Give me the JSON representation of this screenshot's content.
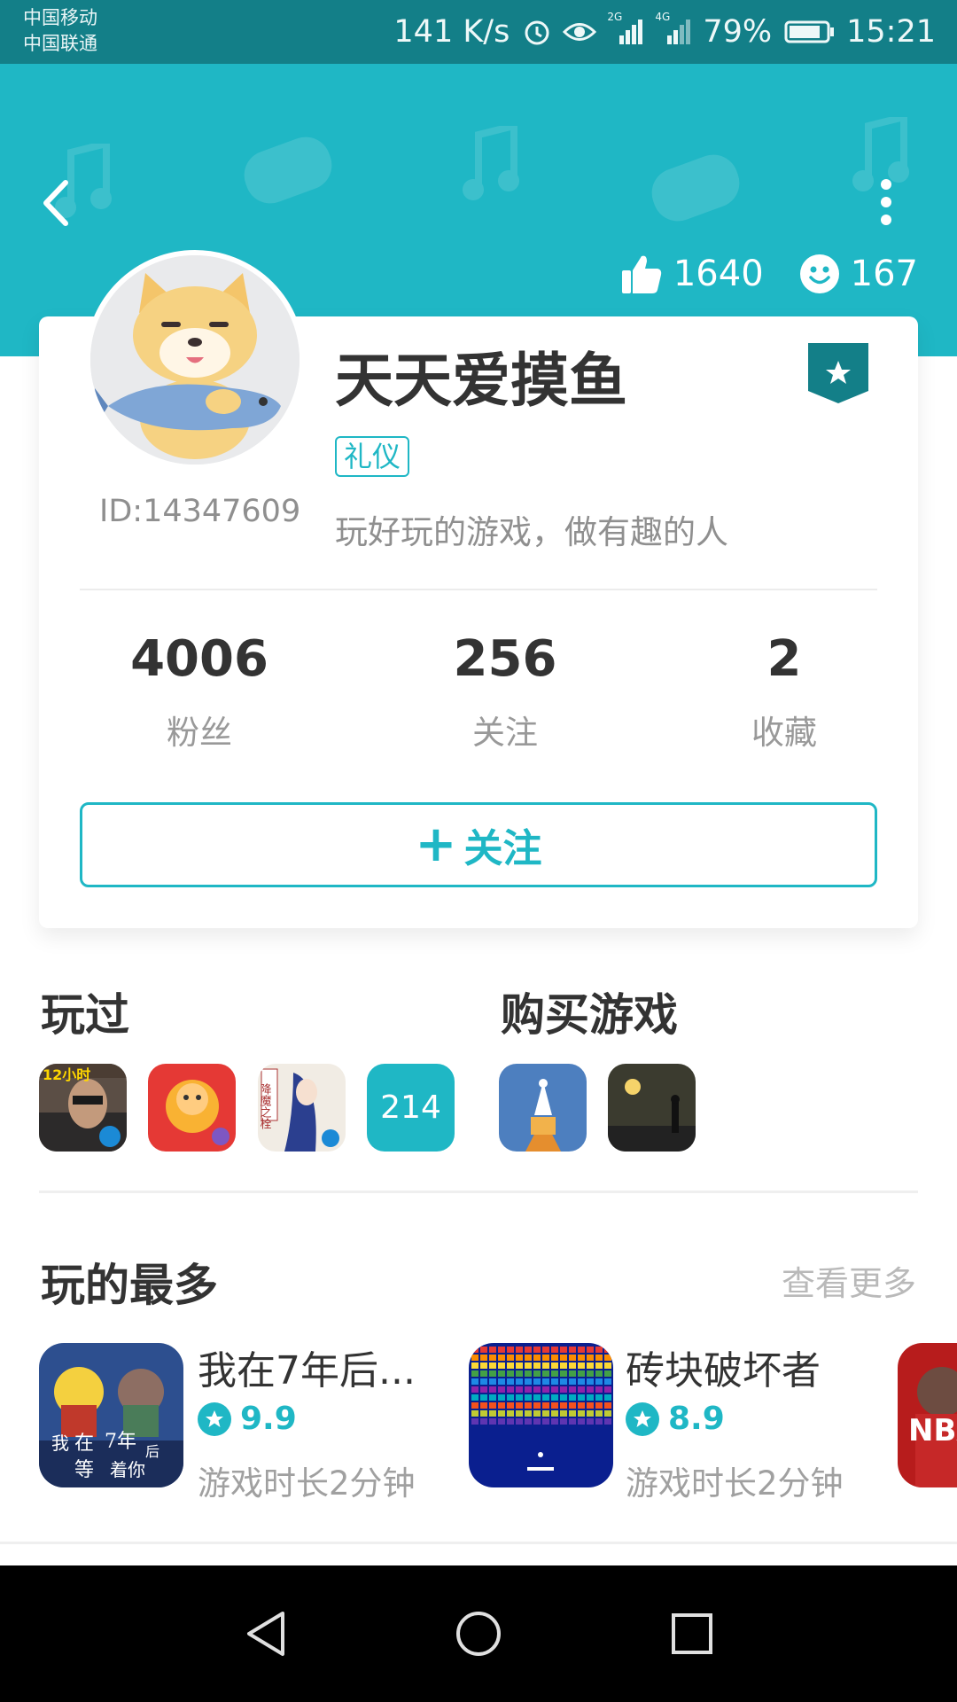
{
  "status_bar": {
    "carrier_1": "中国移动",
    "carrier_2": "中国联通",
    "net_speed": "141 K/s",
    "signal_1": "2G",
    "signal_2": "4G",
    "battery": "79%",
    "time": "15:21"
  },
  "header": {
    "likes": "1640",
    "smiles": "167",
    "colors": {
      "primary": "#1fb7c5",
      "status": "#137f88"
    }
  },
  "profile": {
    "nickname": "天天爱摸鱼",
    "tag": "礼仪",
    "id_label": "ID:14347609",
    "bio": "玩好玩的游戏，做有趣的人",
    "stats": [
      {
        "value": "4006",
        "label": "粉丝"
      },
      {
        "value": "256",
        "label": "关注"
      },
      {
        "value": "2",
        "label": "收藏"
      }
    ],
    "follow_label": "关注"
  },
  "played": {
    "title": "玩过",
    "more_count": "214",
    "icons": [
      "12小时",
      "",
      "降魔之栓"
    ]
  },
  "purchased": {
    "title": "购买游戏"
  },
  "most_played": {
    "title": "玩的最多",
    "see_more": "查看更多",
    "items": [
      {
        "name": "我在7年后...",
        "rating": "9.9",
        "time": "游戏时长2分钟",
        "icon_text": [
          "我",
          "在",
          "7年",
          "后",
          "等",
          "着你"
        ]
      },
      {
        "name": "砖块破坏者",
        "rating": "8.9",
        "time": "游戏时长2分钟"
      },
      {
        "name": "",
        "rating": "",
        "time": "",
        "icon_text": [
          "NBA"
        ]
      }
    ]
  }
}
